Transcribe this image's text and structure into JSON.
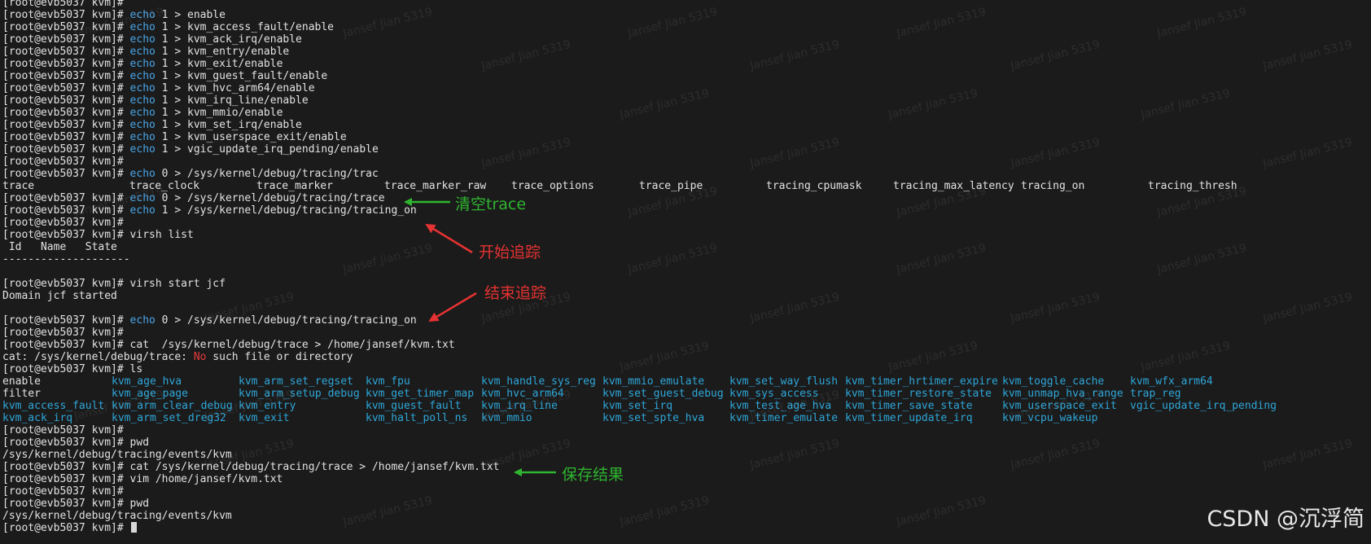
{
  "prompt": "[root@evb5037 kvm]# ",
  "colors": {
    "background": "#1b1b1b",
    "echo": "#4aa5e6",
    "dir": "#2ea6d8",
    "annotation_green": "#2fb52f",
    "annotation_red": "#e63232"
  },
  "top_line": "[root@evb5037 kvm]#",
  "enable_lines": [
    {
      "kw": "echo",
      "rest": " 1 > enable"
    },
    {
      "kw": "echo",
      "rest": " 1 > kvm_access_fault/enable"
    },
    {
      "kw": "echo",
      "rest": " 1 > kvm_ack_irq/enable"
    },
    {
      "kw": "echo",
      "rest": " 1 > kvm_entry/enable"
    },
    {
      "kw": "echo",
      "rest": " 1 > kvm_exit/enable"
    },
    {
      "kw": "echo",
      "rest": " 1 > kvm_guest_fault/enable"
    },
    {
      "kw": "echo",
      "rest": " 1 > kvm_hvc_arm64/enable"
    },
    {
      "kw": "echo",
      "rest": " 1 > kvm_irq_line/enable"
    },
    {
      "kw": "echo",
      "rest": " 1 > kvm_mmio/enable"
    },
    {
      "kw": "echo",
      "rest": " 1 > kvm_set_irq/enable"
    },
    {
      "kw": "echo",
      "rest": " 1 > kvm_userspace_exit/enable"
    },
    {
      "kw": "echo",
      "rest": " 1 > vgic_update_irq_pending/enable"
    }
  ],
  "trac_cmd": {
    "kw": "echo",
    "rest": " 0 > /sys/kernel/debug/tracing/trac"
  },
  "completions": [
    "trace",
    "trace_clock",
    "trace_marker",
    "trace_marker_raw",
    "trace_options",
    "trace_pipe",
    "tracing_cpumask",
    "tracing_max_latency",
    "tracing_on",
    "tracing_thresh"
  ],
  "clear_cmd": {
    "kw": "echo",
    "rest": " 0 > /sys/kernel/debug/tracing/trace"
  },
  "on_cmd": {
    "kw": "echo",
    "rest": " 1 > /sys/kernel/debug/tracing/tracing_on"
  },
  "virsh_list": "virsh list",
  "list_header": " Id   Name   State",
  "list_sep": "--------------------",
  "virsh_start": "virsh start jcf",
  "domain_started": "Domain jcf started",
  "off_cmd": {
    "kw": "echo",
    "rest": " 0 > /sys/kernel/debug/tracing/tracing_on"
  },
  "cat_bad": "cat  /sys/kernel/debug/trace > /home/jansef/kvm.txt",
  "cat_err": {
    "pre": "cat: /sys/kernel/debug/trace: ",
    "no": "No",
    "post": " such file or directory"
  },
  "ls_cmd": "ls",
  "ls_rows": [
    [
      "enable",
      "kvm_age_hva",
      "kvm_arm_set_regset",
      "kvm_fpu",
      "kvm_handle_sys_reg",
      "kvm_mmio_emulate",
      "kvm_set_way_flush",
      "kvm_timer_hrtimer_expire",
      "kvm_toggle_cache",
      "kvm_wfx_arm64"
    ],
    [
      "filter",
      "kvm_age_page",
      "kvm_arm_setup_debug",
      "kvm_get_timer_map",
      "kvm_hvc_arm64",
      "kvm_set_guest_debug",
      "kvm_sys_access",
      "kvm_timer_restore_state",
      "kvm_unmap_hva_range",
      "trap_reg"
    ],
    [
      "kvm_access_fault",
      "kvm_arm_clear_debug",
      "kvm_entry",
      "kvm_guest_fault",
      "kvm_irq_line",
      "kvm_set_irq",
      "kvm_test_age_hva",
      "kvm_timer_save_state",
      "kvm_userspace_exit",
      "vgic_update_irq_pending"
    ],
    [
      "kvm_ack_irq",
      "kvm_arm_set_dreg32",
      "kvm_exit",
      "kvm_halt_poll_ns",
      "kvm_mmio",
      "kvm_set_spte_hva",
      "kvm_timer_emulate",
      "kvm_timer_update_irq",
      "kvm_vcpu_wakeup",
      ""
    ]
  ],
  "pwd_cmd": "pwd",
  "pwd_out": "/sys/kernel/debug/tracing/events/kvm",
  "cat_good": "cat /sys/kernel/debug/tracing/trace > /home/jansef/kvm.txt",
  "vim_cmd": "vim /home/jansef/kvm.txt",
  "annotations": {
    "clear_trace": "清空trace",
    "start_trace": "开始追踪",
    "stop_trace": "结束追踪",
    "save_result": "保存结果"
  },
  "watermark": "Jansef Jian 5319",
  "brand": "CSDN @沉浮简"
}
